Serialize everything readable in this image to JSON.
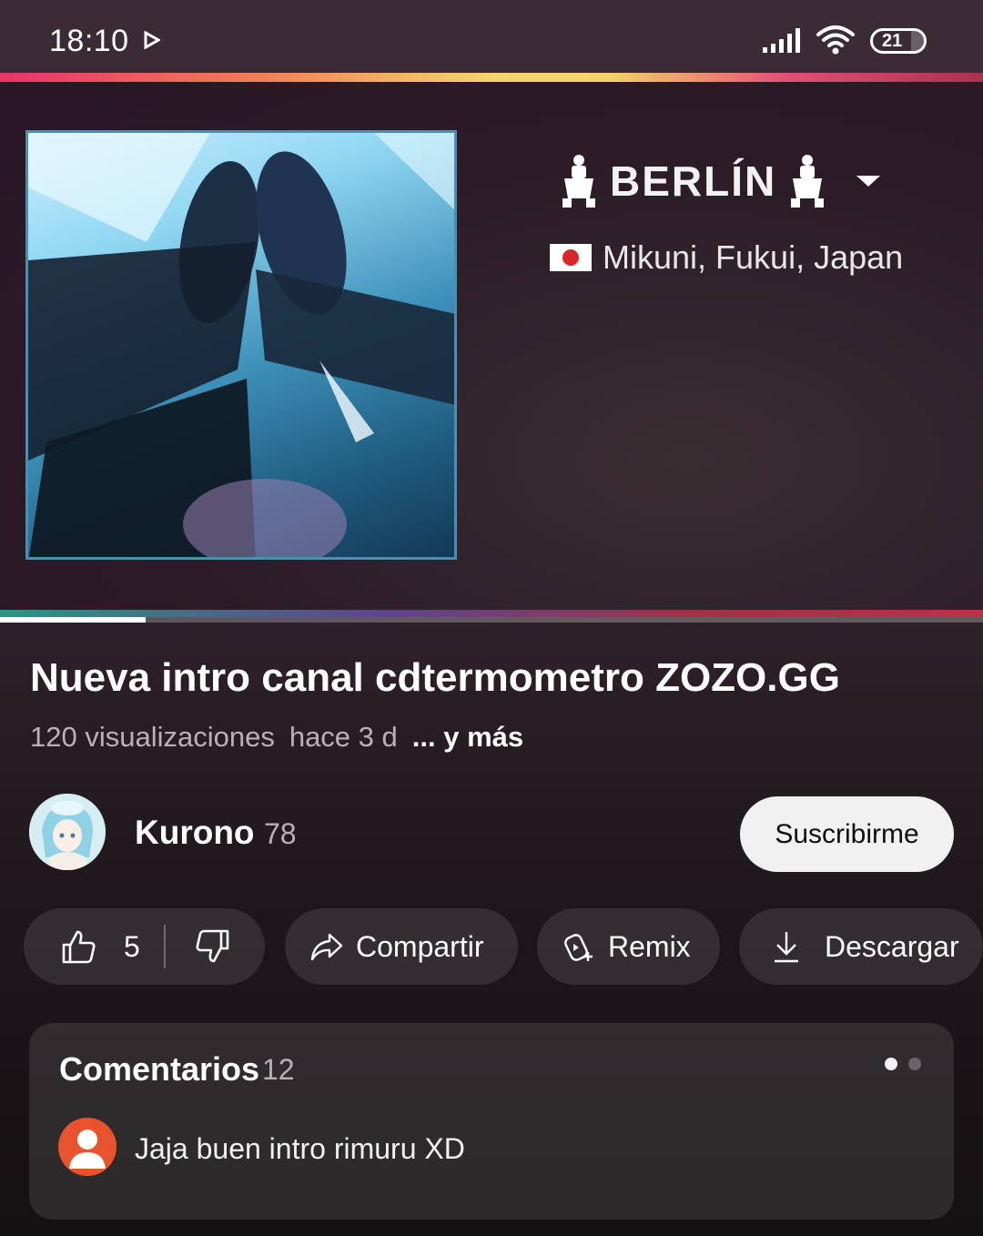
{
  "status_bar": {
    "time": "18:10",
    "battery": "21"
  },
  "video": {
    "overlay_title": "BERLÍN",
    "location": "Mikuni, Fukui, Japan",
    "progress_fraction": 0.148
  },
  "title": "Nueva intro canal cdtermometro ZOZO.GG",
  "meta": {
    "views": "120 visualizaciones",
    "age": "hace 3 d",
    "more": "... y más"
  },
  "channel": {
    "name": "Kurono",
    "subscribers": "78",
    "subscribe_label": "Suscribirme"
  },
  "actions": {
    "likes": "5",
    "share_label": "Compartir",
    "remix_label": "Remix",
    "download_label": "Descargar"
  },
  "comments": {
    "title": "Comentarios",
    "count": "12",
    "top_comment": "Jaja buen intro rimuru XD"
  },
  "colors": {
    "background": "#2e2028",
    "comment_avatar": "#e8532d",
    "subscribe_bg": "#f1f1f1"
  }
}
